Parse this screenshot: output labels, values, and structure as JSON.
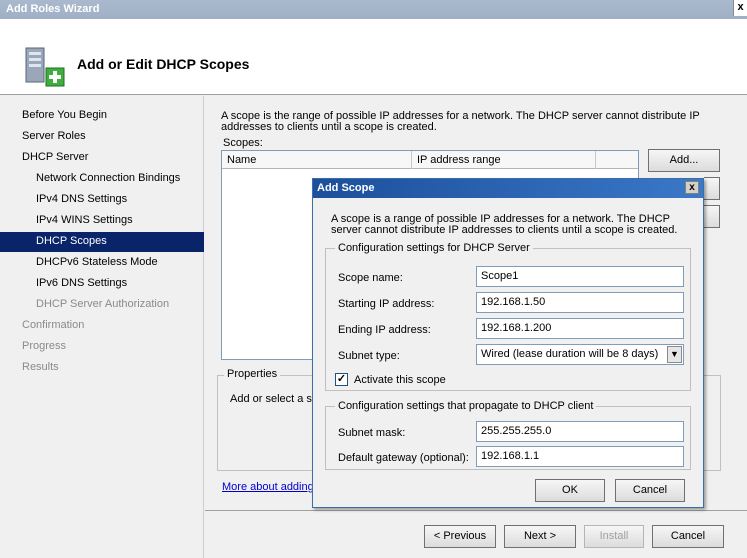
{
  "window": {
    "title": "Add Roles Wizard",
    "close_glyph": "x"
  },
  "header": {
    "title": "Add or Edit DHCP Scopes",
    "icon": "server-add-icon"
  },
  "nav": [
    {
      "label": "Before You Begin",
      "level": 0,
      "state": "normal"
    },
    {
      "label": "Server Roles",
      "level": 0,
      "state": "normal"
    },
    {
      "label": "DHCP Server",
      "level": 0,
      "state": "normal"
    },
    {
      "label": "Network Connection Bindings",
      "level": 1,
      "state": "normal"
    },
    {
      "label": "IPv4 DNS Settings",
      "level": 1,
      "state": "normal"
    },
    {
      "label": "IPv4 WINS Settings",
      "level": 1,
      "state": "normal"
    },
    {
      "label": "DHCP Scopes",
      "level": 1,
      "state": "selected"
    },
    {
      "label": "DHCPv6 Stateless Mode",
      "level": 1,
      "state": "normal"
    },
    {
      "label": "IPv6 DNS Settings",
      "level": 1,
      "state": "normal"
    },
    {
      "label": "DHCP Server Authorization",
      "level": 1,
      "state": "disabled"
    },
    {
      "label": "Confirmation",
      "level": 0,
      "state": "disabled"
    },
    {
      "label": "Progress",
      "level": 0,
      "state": "disabled"
    },
    {
      "label": "Results",
      "level": 0,
      "state": "disabled"
    }
  ],
  "main": {
    "description": "A scope is the range of possible IP addresses for a network. The DHCP server cannot distribute IP addresses to clients until a scope is created.",
    "scopes_label": "Scopes:",
    "columns": [
      "Name",
      "IP address range",
      ""
    ],
    "add_button": "Add...",
    "properties_label": "Properties",
    "properties_text": "Add or select a sc",
    "more_link": "More about adding"
  },
  "footer": {
    "previous": "< Previous",
    "next": "Next >",
    "install": "Install",
    "cancel": "Cancel"
  },
  "dialog": {
    "title": "Add Scope",
    "close_glyph": "x",
    "description": "A scope is a range of possible IP addresses for a network. The DHCP server cannot distribute IP addresses to clients until a scope is created.",
    "config_group": "Configuration settings for DHCP Server",
    "scope_name_label": "Scope name:",
    "scope_name_value": "Scope1",
    "start_ip_label": "Starting IP address:",
    "start_ip_value": "192.168.1.50",
    "end_ip_label": "Ending IP address:",
    "end_ip_value": "192.168.1.200",
    "subnet_type_label": "Subnet type:",
    "subnet_type_value": "Wired (lease duration will be 8 days)",
    "activate_label": "Activate this scope",
    "activate_checked": true,
    "propagate_group": "Configuration settings that propagate to DHCP client",
    "subnet_mask_label": "Subnet mask:",
    "subnet_mask_value": "255.255.255.0",
    "gateway_label": "Default gateway (optional):",
    "gateway_value": "192.168.1.1",
    "ok": "OK",
    "cancel": "Cancel"
  },
  "colors": {
    "selection": "#0a246a",
    "dialog_title": "#1c4f9c",
    "link": "#0000cc"
  }
}
